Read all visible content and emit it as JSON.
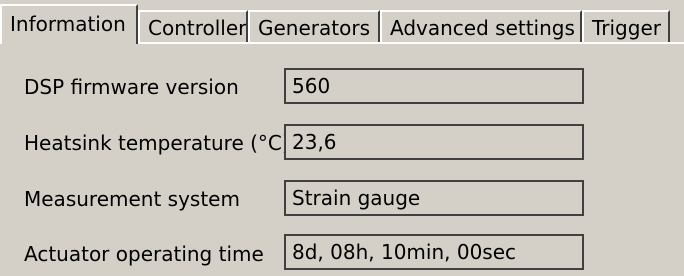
{
  "tabs": [
    {
      "label": "Information",
      "active": true
    },
    {
      "label": "Controller",
      "active": false
    },
    {
      "label": "Generators",
      "active": false
    },
    {
      "label": "Advanced settings",
      "active": false
    },
    {
      "label": "Trigger",
      "active": false
    }
  ],
  "info": {
    "rows": [
      {
        "label": "DSP firmware version",
        "value": "560"
      },
      {
        "label": "Heatsink temperature (°C)",
        "value": "23,6"
      },
      {
        "label": "Measurement system",
        "value": "Strain gauge"
      },
      {
        "label": "Actuator operating time",
        "value": "8d, 08h, 10min, 00sec"
      }
    ]
  }
}
